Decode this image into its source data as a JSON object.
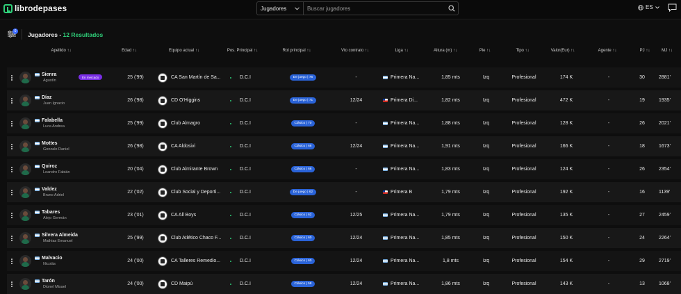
{
  "brand": {
    "name": "librodepases"
  },
  "search": {
    "category": "Jugadores",
    "placeholder": "Buscar jugadores"
  },
  "language": "ES",
  "filter_count": "0",
  "heading": {
    "title": "Jugadores - ",
    "count": "12 Resultados"
  },
  "columns": [
    "Apellido ↑↓",
    "Edad ↑↓",
    "Equipo actual ↑↓",
    "Pos. Principal ↑↓",
    "Rol principal ↑↓",
    "Vto contrato ↑↓",
    "Liga ↑↓",
    "Altura (m) ↑↓",
    "Pie ↑↓",
    "Tipo ↑↓",
    "Valor(Eur) ↑↓",
    "Agente ↑↓",
    "PJ ↑↓",
    "MJ ↑↓"
  ],
  "players": [
    {
      "name": "Sienra",
      "full": "Agustín",
      "badge": "En mercado",
      "age": "25 ('99)",
      "team": "CA San Martín de Sa...",
      "pos": "D.C.I",
      "role": "De juego | 76",
      "vto": "-",
      "liga": "Primera Na...",
      "flag": "ar",
      "altura": "1,85 mts",
      "pie": "Izq",
      "tipo": "Profesional",
      "valor": "174 K",
      "agente": "-",
      "pj": "30",
      "mj": "2881'"
    },
    {
      "name": "Díaz",
      "full": "Juan Ignacio",
      "badge": "",
      "age": "26 ('98)",
      "team": "CD O'Higgins",
      "pos": "D.C.I",
      "role": "De juego | 71",
      "vto": "12/24",
      "liga": "Primera Di...",
      "flag": "cl",
      "altura": "1,82 mts",
      "pie": "Izq",
      "tipo": "Profesional",
      "valor": "472 K",
      "agente": "-",
      "pj": "19",
      "mj": "1935'"
    },
    {
      "name": "Falabella",
      "full": "Luca Andrea",
      "badge": "",
      "age": "25 ('99)",
      "team": "Club Almagro",
      "pos": "D.C.I",
      "role": "Clásico | 70",
      "vto": "-",
      "liga": "Primera Na...",
      "flag": "ar",
      "altura": "1,88 mts",
      "pie": "Izq",
      "tipo": "Profesional",
      "valor": "128 K",
      "agente": "-",
      "pj": "26",
      "mj": "2021'"
    },
    {
      "name": "Mottes",
      "full": "Gonzalo Daniel",
      "badge": "",
      "age": "26 ('98)",
      "team": "CA Aldosivi",
      "pos": "D.C.I",
      "role": "Clásico | 68",
      "vto": "12/24",
      "liga": "Primera Na...",
      "flag": "ar",
      "altura": "1,91 mts",
      "pie": "Izq",
      "tipo": "Profesional",
      "valor": "166 K",
      "agente": "-",
      "pj": "18",
      "mj": "1673'"
    },
    {
      "name": "Quiroz",
      "full": "Leandro Fabián",
      "badge": "",
      "age": "20 ('04)",
      "team": "Club Almirante Brown",
      "pos": "D.C.I",
      "role": "Clásico | 66",
      "vto": "-",
      "liga": "Primera Na...",
      "flag": "ar",
      "altura": "1,83 mts",
      "pie": "Izq",
      "tipo": "Profesional",
      "valor": "124 K",
      "agente": "-",
      "pj": "26",
      "mj": "2354'"
    },
    {
      "name": "Valdez",
      "full": "Bruno Adriel",
      "badge": "",
      "age": "22 ('02)",
      "team": "Club Social y Deporti...",
      "pos": "D.C.I",
      "role": "De juego | 62",
      "vto": "-",
      "liga": "Primera B",
      "flag": "cl",
      "altura": "1,79 mts",
      "pie": "Izq",
      "tipo": "Profesional",
      "valor": "192 K",
      "agente": "-",
      "pj": "16",
      "mj": "1139'"
    },
    {
      "name": "Tabares",
      "full": "Alejo Germán",
      "badge": "",
      "age": "23 ('01)",
      "team": "CA All Boys",
      "pos": "D.C.I",
      "role": "Clásico | 62",
      "vto": "12/25",
      "liga": "Primera Na...",
      "flag": "ar",
      "altura": "1,79 mts",
      "pie": "Izq",
      "tipo": "Profesional",
      "valor": "135 K",
      "agente": "-",
      "pj": "27",
      "mj": "2459'"
    },
    {
      "name": "Silvera Almeida",
      "full": "Mathias Emanuel",
      "badge": "",
      "age": "25 ('99)",
      "team": "Club Atlético Chaco F...",
      "pos": "D.C.I",
      "role": "Clásico | 60",
      "vto": "12/24",
      "liga": "Primera Na...",
      "flag": "ar",
      "altura": "1,85 mts",
      "pie": "Izq",
      "tipo": "Profesional",
      "valor": "150 K",
      "agente": "-",
      "pj": "24",
      "mj": "2264'"
    },
    {
      "name": "Malvacio",
      "full": "Nicolás",
      "badge": "",
      "age": "24 ('00)",
      "team": "CA Talleres Remedio...",
      "pos": "D.C.I",
      "role": "Clásico | 60",
      "vto": "12/24",
      "liga": "Primera Na...",
      "flag": "ar",
      "altura": "1,8 mts",
      "pie": "Izq",
      "tipo": "Profesional",
      "valor": "154 K",
      "agente": "-",
      "pj": "29",
      "mj": "2719'"
    },
    {
      "name": "Tarón",
      "full": "Dionel Misael",
      "badge": "",
      "age": "24 ('00)",
      "team": "CD Maipú",
      "pos": "D.C.I",
      "role": "Clásico | 58",
      "vto": "12/24",
      "liga": "Primera Na...",
      "flag": "ar",
      "altura": "1,86 mts",
      "pie": "Izq",
      "tipo": "Profesional",
      "valor": "143 K",
      "agente": "-",
      "pj": "13",
      "mj": "1068'"
    }
  ]
}
